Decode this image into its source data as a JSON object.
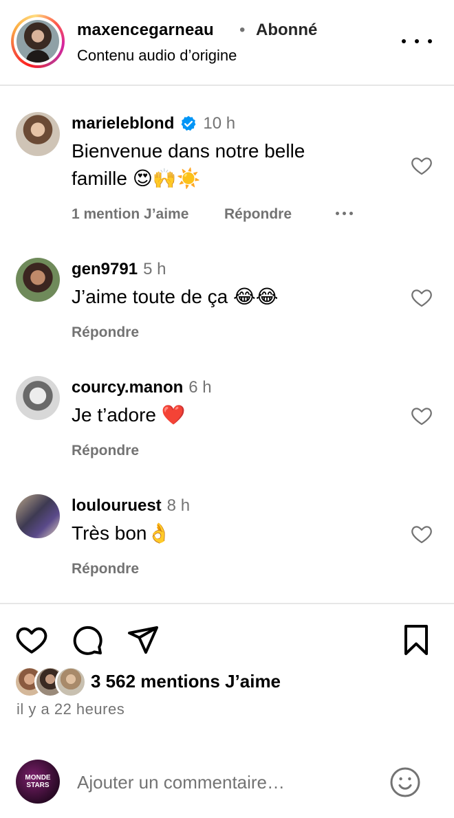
{
  "header": {
    "username": "maxencegarneau",
    "separator": "•",
    "follow_status": "Abonné",
    "audio_label": "Contenu audio d’origine",
    "more_icon": "more-horizontal-icon"
  },
  "comments": [
    {
      "username": "marieleblond",
      "verified": true,
      "time": "10 h",
      "text": "Bienvenue dans notre belle famille 😍🙌☀️",
      "likes_label": "1 mention J’aime",
      "reply_label": "Répondre",
      "has_more": true
    },
    {
      "username": "gen9791",
      "verified": false,
      "time": "5 h",
      "text": "J’aime toute de ça 😂😂",
      "reply_label": "Répondre"
    },
    {
      "username": "courcy.manon",
      "verified": false,
      "time": "6 h",
      "text": "Je t’adore ❤️",
      "reply_label": "Répondre"
    },
    {
      "username": "loulouruest",
      "verified": false,
      "time": "8 h",
      "text": "Très bon👌",
      "reply_label": "Répondre"
    }
  ],
  "actions": {
    "like_icon": "heart-icon",
    "comment_icon": "comment-icon",
    "share_icon": "send-icon",
    "save_icon": "bookmark-icon"
  },
  "post": {
    "likes": "3 562 mentions J’aime",
    "posted": "il y a 22 heures"
  },
  "comment_bar": {
    "avatar_text_1": "MONDE",
    "avatar_text_2": "STARS",
    "placeholder": "Ajouter un commentaire…",
    "emoji_icon": "smiley-icon"
  },
  "colors": {
    "secondary_text": "#737373",
    "verified_blue": "#0095f6",
    "divider": "#e6e6e6"
  }
}
